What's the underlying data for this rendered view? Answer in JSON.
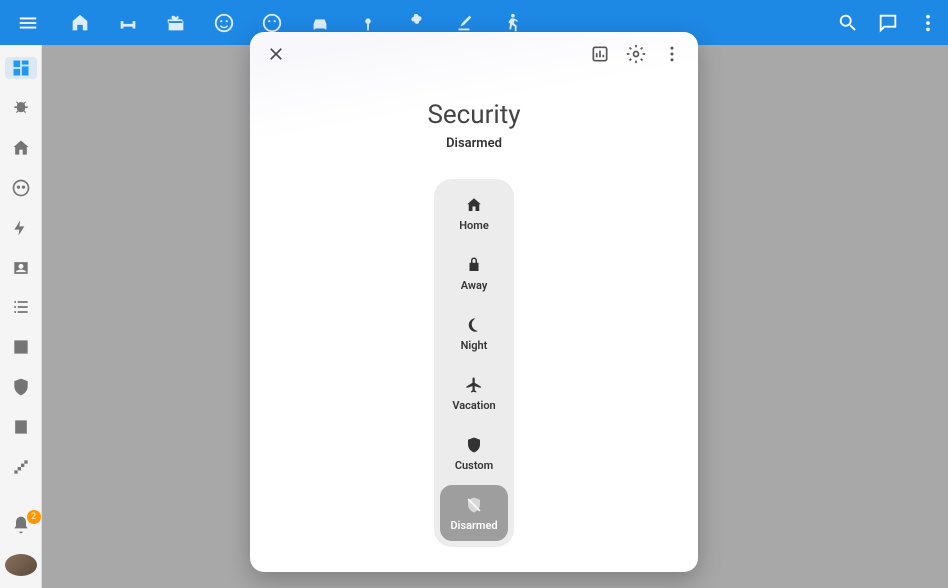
{
  "header": {
    "tabs": [
      "home-plus",
      "sofa",
      "gift",
      "smile",
      "face",
      "car",
      "fan",
      "flower",
      "paint",
      "run"
    ]
  },
  "sidebar": {
    "items": [
      "dashboard",
      "bug",
      "house",
      "face",
      "flash",
      "contact",
      "list",
      "chart",
      "shield",
      "calendar",
      "stairs"
    ],
    "active_index": 0,
    "notification_count": "2"
  },
  "dialog": {
    "title": "Security",
    "subtitle": "Disarmed",
    "modes": [
      {
        "id": "home",
        "label": "Home",
        "icon": "home"
      },
      {
        "id": "away",
        "label": "Away",
        "icon": "lock"
      },
      {
        "id": "night",
        "label": "Night",
        "icon": "moon"
      },
      {
        "id": "vacation",
        "label": "Vacation",
        "icon": "airplane"
      },
      {
        "id": "custom",
        "label": "Custom",
        "icon": "shield"
      },
      {
        "id": "disarmed",
        "label": "Disarmed",
        "icon": "shield-off"
      }
    ],
    "selected_mode": "disarmed"
  }
}
